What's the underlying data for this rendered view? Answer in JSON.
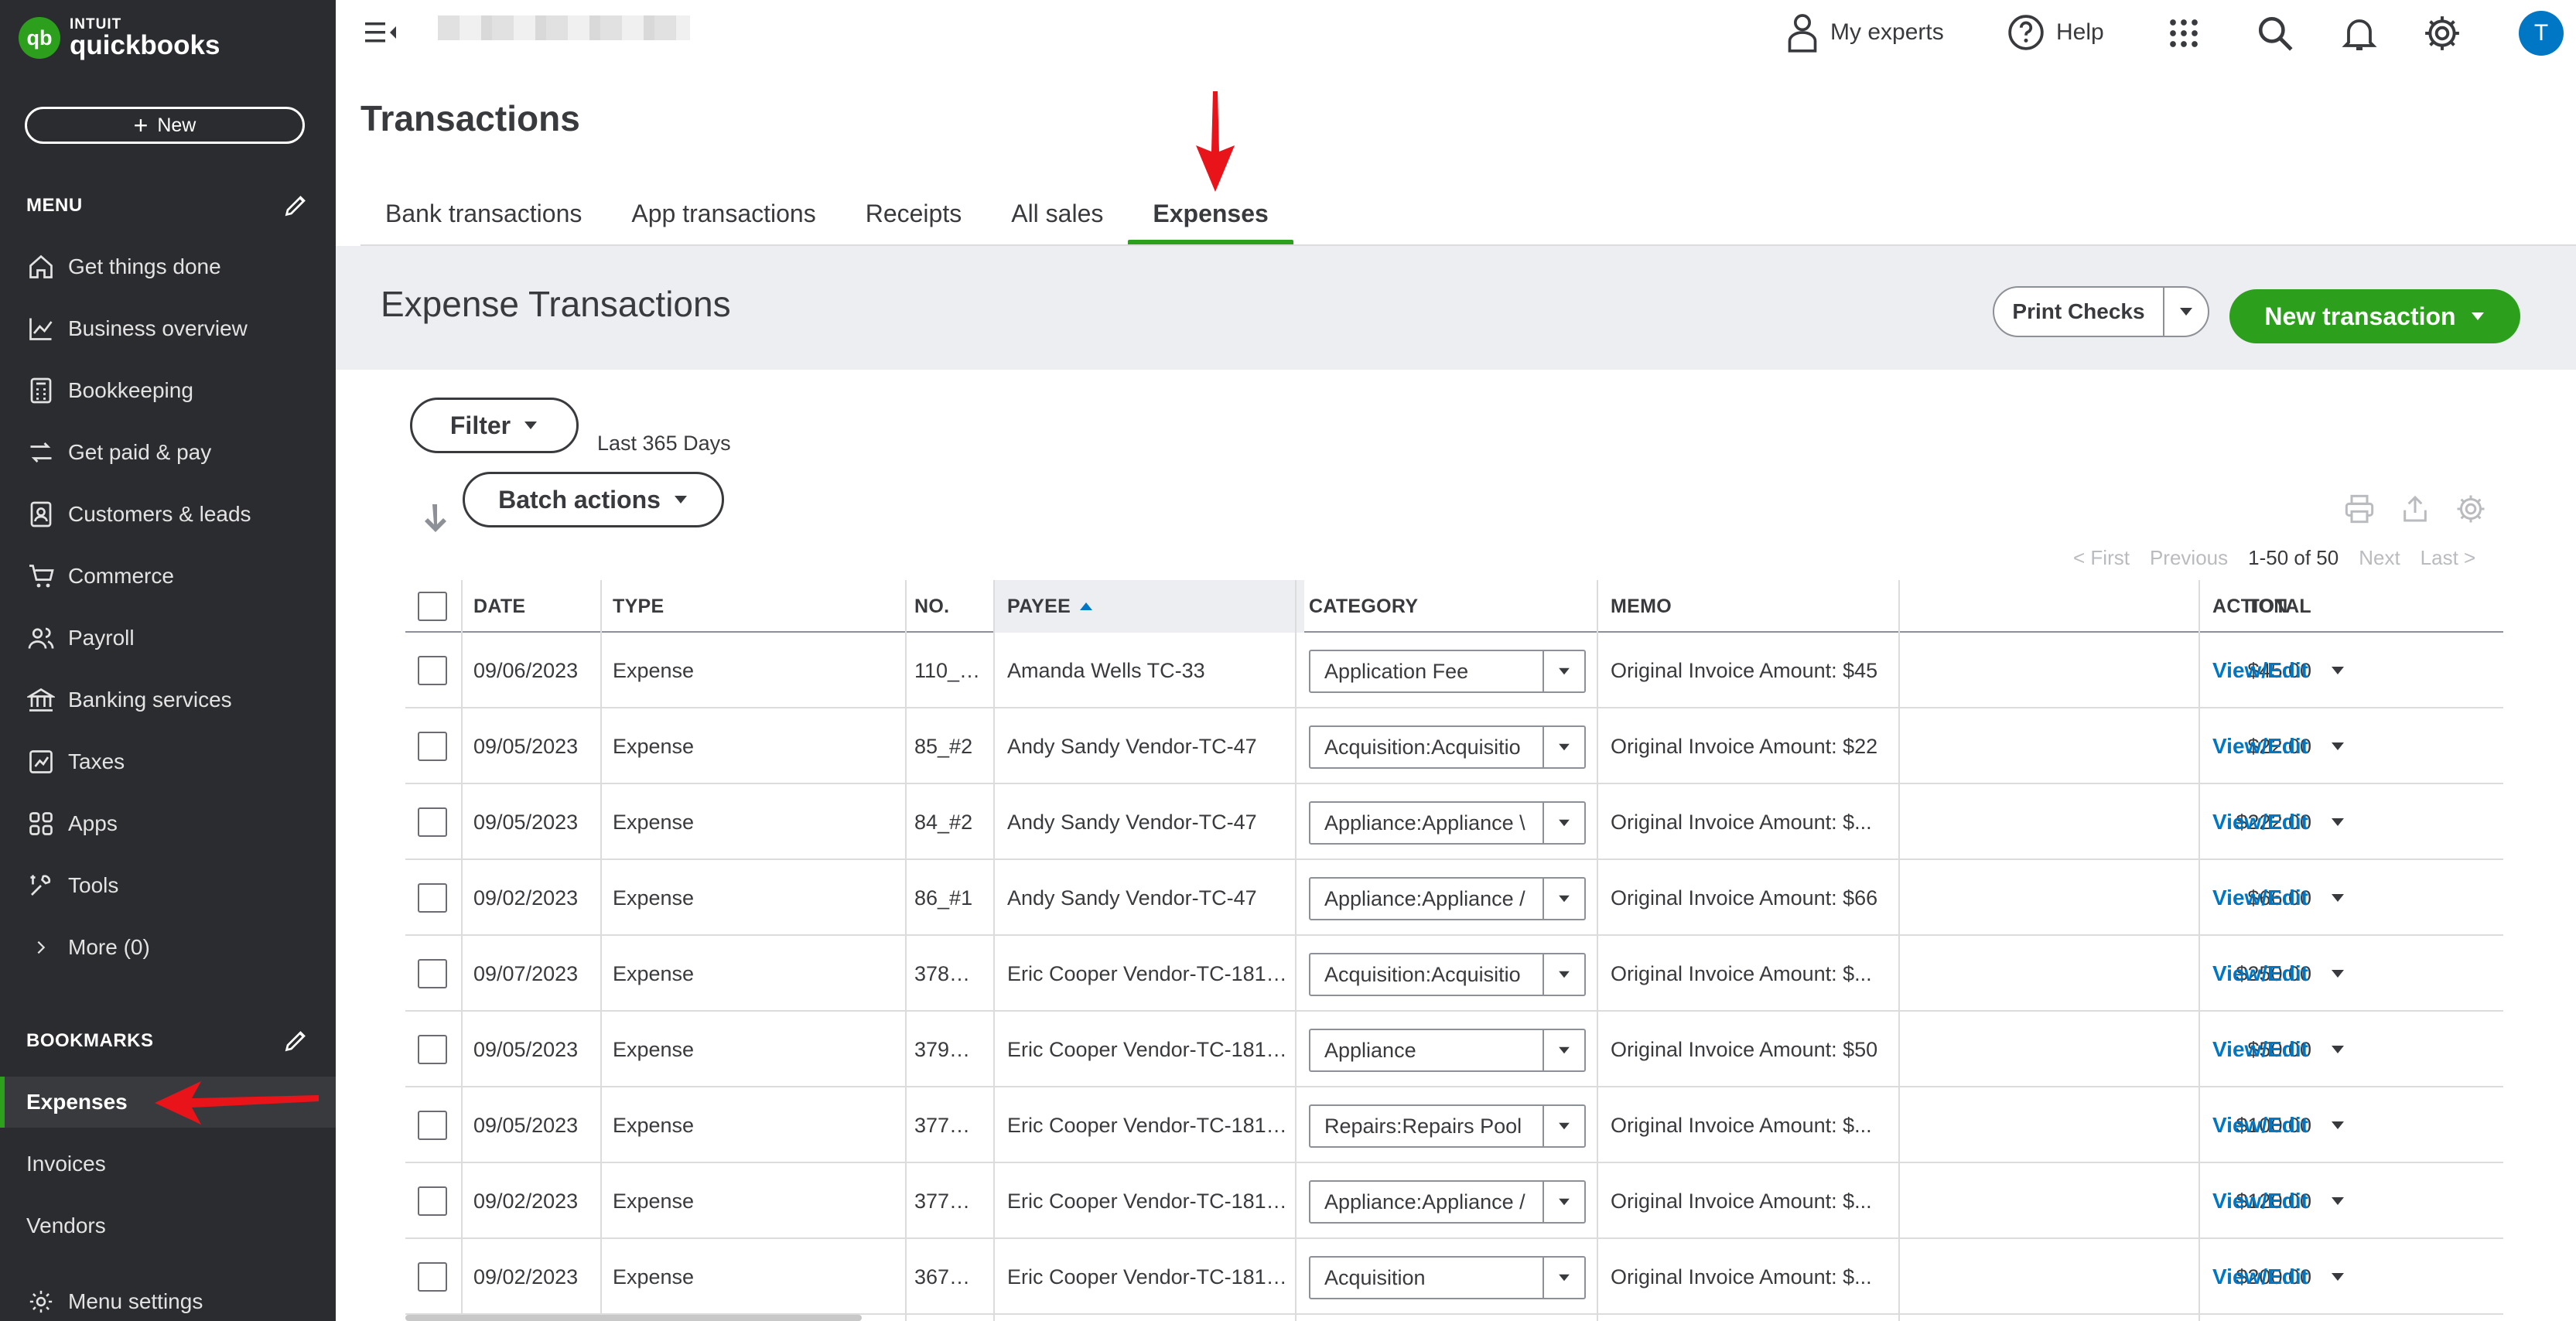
{
  "brand": {
    "line1": "INTUIT",
    "line2": "quickbooks",
    "mark": "qb",
    "color": "#2ca01c"
  },
  "sidebar": {
    "new_label": "New",
    "menu_heading": "MENU",
    "items": [
      {
        "label": "Get things done",
        "icon": "home-icon"
      },
      {
        "label": "Business overview",
        "icon": "chart-icon"
      },
      {
        "label": "Bookkeeping",
        "icon": "calculator-icon"
      },
      {
        "label": "Get paid & pay",
        "icon": "exchange-icon"
      },
      {
        "label": "Customers & leads",
        "icon": "contacts-icon"
      },
      {
        "label": "Commerce",
        "icon": "cart-icon"
      },
      {
        "label": "Payroll",
        "icon": "people-icon"
      },
      {
        "label": "Banking services",
        "icon": "bank-icon"
      },
      {
        "label": "Taxes",
        "icon": "tax-icon"
      },
      {
        "label": "Apps",
        "icon": "apps-icon"
      },
      {
        "label": "Tools",
        "icon": "tools-icon"
      }
    ],
    "more_label": "More (0)",
    "bookmarks_heading": "BOOKMARKS",
    "bookmarks": [
      "Expenses",
      "Invoices",
      "Vendors"
    ],
    "menu_settings": "Menu settings"
  },
  "topbar": {
    "my_experts": "My experts",
    "help": "Help",
    "avatar_initial": "T"
  },
  "page": {
    "title": "Transactions",
    "tabs": [
      "Bank transactions",
      "App transactions",
      "Receipts",
      "All sales",
      "Expenses"
    ],
    "active_tab": "Expenses"
  },
  "expenses": {
    "title": "Expense Transactions",
    "print_checks": "Print Checks",
    "new_transaction": "New transaction",
    "filter": "Filter",
    "range": "Last 365 Days",
    "batch_actions": "Batch actions",
    "pager": {
      "first": "< First",
      "previous": "Previous",
      "current": "1-50 of 50",
      "next": "Next",
      "last": "Last >"
    },
    "columns": {
      "date": "DATE",
      "type": "TYPE",
      "no": "NO.",
      "payee": "PAYEE",
      "category": "CATEGORY",
      "memo": "MEMO",
      "total": "TOTAL",
      "action": "ACTION"
    },
    "rows": [
      {
        "date": "09/06/2023",
        "type": "Expense",
        "no": "110_…",
        "payee": "Amanda Wells TC-33",
        "category": "Application Fee",
        "memo": "Original Invoice Amount: $45",
        "total": "$45.00",
        "action": "View/Edit"
      },
      {
        "date": "09/05/2023",
        "type": "Expense",
        "no": "85_#2",
        "payee": "Andy Sandy Vendor-TC-47",
        "category": "Acquisition:Acquisitio",
        "memo": "Original Invoice Amount: $22",
        "total": "$22.00",
        "action": "View/Edit"
      },
      {
        "date": "09/05/2023",
        "type": "Expense",
        "no": "84_#2",
        "payee": "Andy Sandy Vendor-TC-47",
        "category": "Appliance:Appliance \\",
        "memo": "Original Invoice Amount: $...",
        "total": "$222.00",
        "action": "View/Edit"
      },
      {
        "date": "09/02/2023",
        "type": "Expense",
        "no": "86_#1",
        "payee": "Andy Sandy Vendor-TC-47",
        "category": "Appliance:Appliance /",
        "memo": "Original Invoice Amount: $66",
        "total": "$66.00",
        "action": "View/Edit"
      },
      {
        "date": "09/07/2023",
        "type": "Expense",
        "no": "378…",
        "payee": "Eric Cooper Vendor-TC-181…",
        "category": "Acquisition:Acquisitio",
        "memo": "Original Invoice Amount: $...",
        "total": "$250.00",
        "action": "View/Edit"
      },
      {
        "date": "09/05/2023",
        "type": "Expense",
        "no": "379…",
        "payee": "Eric Cooper Vendor-TC-181…",
        "category": "Appliance",
        "memo": "Original Invoice Amount: $50",
        "total": "$50.00",
        "action": "View/Edit"
      },
      {
        "date": "09/05/2023",
        "type": "Expense",
        "no": "377…",
        "payee": "Eric Cooper Vendor-TC-181…",
        "category": "Repairs:Repairs Pool",
        "memo": "Original Invoice Amount: $...",
        "total": "$100.00",
        "action": "View/Edit"
      },
      {
        "date": "09/02/2023",
        "type": "Expense",
        "no": "377…",
        "payee": "Eric Cooper Vendor-TC-181…",
        "category": "Appliance:Appliance /",
        "memo": "Original Invoice Amount: $...",
        "total": "$120.00",
        "action": "View/Edit"
      },
      {
        "date": "09/02/2023",
        "type": "Expense",
        "no": "367…",
        "payee": "Eric Cooper Vendor-TC-181…",
        "category": "Acquisition",
        "memo": "Original Invoice Amount: $...",
        "total": "$200.00",
        "action": "View/Edit"
      }
    ]
  },
  "colors": {
    "accent": "#2ca01c",
    "link": "#0077c5",
    "sidebar": "#2b2c2f",
    "annotation": "#e8141a"
  }
}
